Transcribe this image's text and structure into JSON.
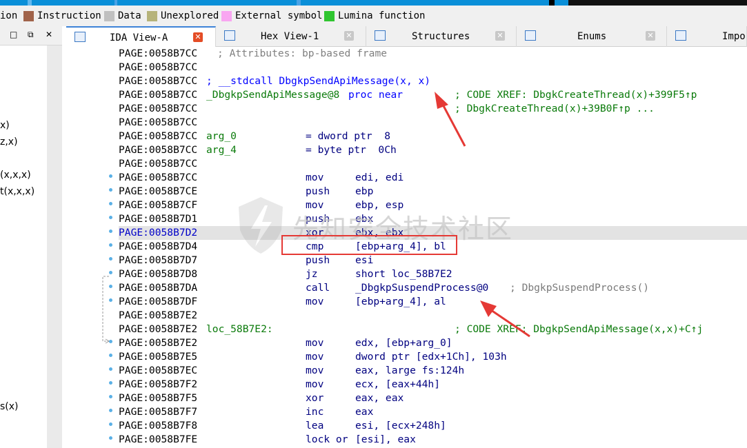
{
  "legend": {
    "items": [
      {
        "label": "ion",
        "swatch": ""
      },
      {
        "label": "Instruction",
        "swatch": "#a0634a"
      },
      {
        "label": "Data",
        "swatch": "#c0c0c0"
      },
      {
        "label": "Unexplored",
        "swatch": "#b6b37a"
      },
      {
        "label": "External symbol",
        "swatch": "#f9a6f1"
      },
      {
        "label": "Lumina function",
        "swatch": "#2fc52f"
      }
    ]
  },
  "left_panel": {
    "buttons": [
      "□",
      "⧉",
      "✕"
    ],
    "functions": [
      "x)",
      "z,x)",
      "(x,x,x)",
      "t(x,x,x)",
      "s(x)"
    ]
  },
  "tabs": [
    {
      "label": "IDA View-A",
      "active": true,
      "close": "✕"
    },
    {
      "label": "Hex View-1",
      "active": false,
      "close": "✕"
    },
    {
      "label": "Structures",
      "active": false,
      "close": "✕"
    },
    {
      "label": "Enums",
      "active": false,
      "close": "✕"
    },
    {
      "label": "Impor",
      "active": false,
      "close": ""
    }
  ],
  "disasm": {
    "lines": [
      {
        "addr": "PAGE:0058B7CC",
        "comment": "; Attributes: bp-based frame"
      },
      {
        "addr": "PAGE:0058B7CC"
      },
      {
        "addr": "PAGE:0058B7CC",
        "proto": "; __stdcall DbgkpSendApiMessage(x, x)"
      },
      {
        "addr": "PAGE:0058B7CC",
        "label": "_DbgkpSendApiMessage@8",
        "kw": "proc near",
        "xref": "; CODE XREF: DbgkCreateThread(x)+399F5↑p"
      },
      {
        "addr": "PAGE:0058B7CC",
        "xref": "; DbgkCreateThread(x)+39B0F↑p ..."
      },
      {
        "addr": "PAGE:0058B7CC"
      },
      {
        "addr": "PAGE:0058B7CC",
        "label": "arg_0",
        "argdef": "= dword ptr  8"
      },
      {
        "addr": "PAGE:0058B7CC",
        "label": "arg_4",
        "argdef": "= byte ptr  0Ch"
      },
      {
        "addr": "PAGE:0058B7CC"
      },
      {
        "addr": "PAGE:0058B7CC",
        "op": "mov",
        "args": "edi, edi"
      },
      {
        "addr": "PAGE:0058B7CE",
        "op": "push",
        "args": "ebp"
      },
      {
        "addr": "PAGE:0058B7CF",
        "op": "mov",
        "args": "ebp, esp"
      },
      {
        "addr": "PAGE:0058B7D1",
        "op": "push",
        "args": "ebx"
      },
      {
        "addr": "PAGE:0058B7D2",
        "op": "xor",
        "args": "ebx, ebx",
        "highlight": true
      },
      {
        "addr": "PAGE:0058B7D4",
        "op": "cmp",
        "args": "[ebp+arg_4], bl"
      },
      {
        "addr": "PAGE:0058B7D7",
        "op": "push",
        "args": "esi"
      },
      {
        "addr": "PAGE:0058B7D8",
        "op": "jz",
        "args": "short loc_58B7E2"
      },
      {
        "addr": "PAGE:0058B7DA",
        "op": "call",
        "args": "_DbgkpSuspendProcess@0",
        "cmt": "; DbgkpSuspendProcess()"
      },
      {
        "addr": "PAGE:0058B7DF",
        "op": "mov",
        "args": "[ebp+arg_4], al"
      },
      {
        "addr": "PAGE:0058B7E2"
      },
      {
        "addr": "PAGE:0058B7E2",
        "label": "loc_58B7E2:",
        "xref": "; CODE XREF: DbgkpSendApiMessage(x,x)+C↑j"
      },
      {
        "addr": "PAGE:0058B7E2",
        "op": "mov",
        "args": "edx, [ebp+arg_0]"
      },
      {
        "addr": "PAGE:0058B7E5",
        "op": "mov",
        "args": "dword ptr [edx+1Ch], 103h"
      },
      {
        "addr": "PAGE:0058B7EC",
        "op": "mov",
        "args": "eax, large fs:124h"
      },
      {
        "addr": "PAGE:0058B7F2",
        "op": "mov",
        "args": "ecx, [eax+44h]"
      },
      {
        "addr": "PAGE:0058B7F5",
        "op": "xor",
        "args": "eax, eax"
      },
      {
        "addr": "PAGE:0058B7F7",
        "op": "inc",
        "args": "eax"
      },
      {
        "addr": "PAGE:0058B7F8",
        "op": "lea",
        "args": "esi, [ecx+248h]"
      },
      {
        "addr": "PAGE:0058B7FE",
        "op": "lock or",
        "args": "[esi], eax"
      }
    ]
  },
  "watermark": {
    "text": "先知安全技术社区"
  },
  "colors": {
    "accent": "#3c82d7",
    "navband": "#0a8fd8",
    "annotation": "#e53935",
    "label_green": "#0a7a0a",
    "operand_navy": "#000080"
  }
}
